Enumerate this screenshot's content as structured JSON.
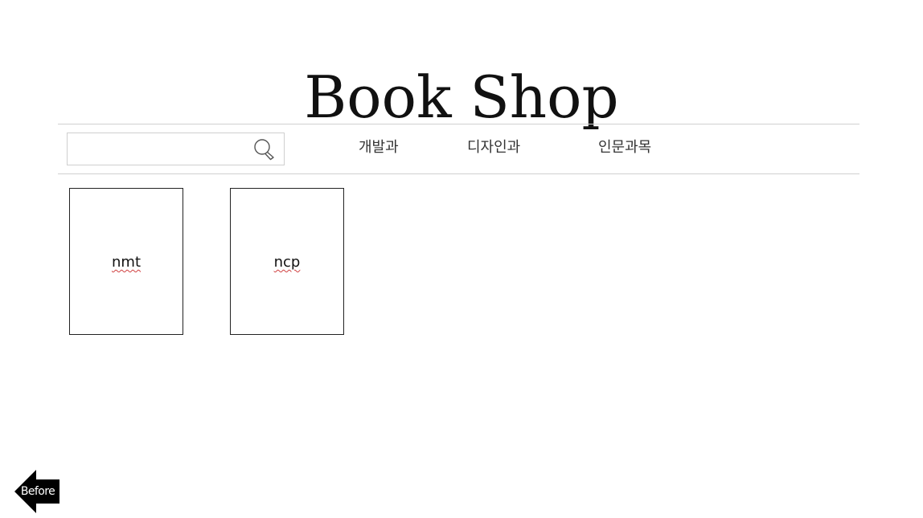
{
  "header": {
    "title": "Book Shop"
  },
  "search": {
    "value": "",
    "placeholder": "",
    "icon": "search-icon"
  },
  "nav": {
    "items": [
      {
        "label": "개발과"
      },
      {
        "label": "디자인과"
      },
      {
        "label": "인문과목"
      }
    ]
  },
  "books": [
    {
      "title": "nmt"
    },
    {
      "title": "ncp"
    }
  ],
  "footer": {
    "before_label": "Before",
    "before_icon": "arrow-left-icon"
  },
  "colors": {
    "text": "#111111",
    "rule": "#d0d0d0",
    "border": "#222222",
    "spellcheck_underline": "#d04040",
    "arrow": "#000000"
  }
}
